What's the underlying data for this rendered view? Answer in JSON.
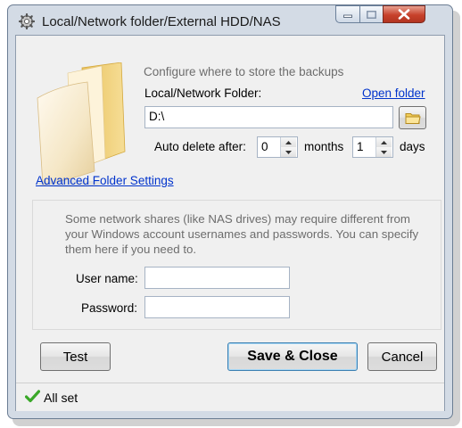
{
  "window": {
    "title": "Local/Network folder/External HDD/NAS",
    "icons": {
      "title": "gear-icon",
      "minimize": "minimize-icon",
      "maximize": "maximize-icon",
      "close": "close-icon"
    }
  },
  "main": {
    "description": "Configure where to store the backups",
    "folder_label": "Local/Network Folder:",
    "open_folder_link": "Open folder",
    "folder_value": "D:\\",
    "browse_icon": "folder-icon",
    "auto_delete_label": "Auto delete after:",
    "months_value": "0",
    "months_label": "months",
    "days_value": "1",
    "days_label": "days",
    "advanced_link": "Advanced Folder Settings"
  },
  "credentials": {
    "info": "Some network shares (like NAS drives) may require different from your Windows account usernames and passwords. You can specify them here if you need to.",
    "username_label": "User name:",
    "username_value": "",
    "password_label": "Password:",
    "password_value": ""
  },
  "buttons": {
    "test": "Test",
    "save_close": "Save & Close",
    "cancel": "Cancel"
  },
  "status": {
    "icon": "checkmark-icon",
    "text": "All set"
  },
  "colors": {
    "link": "#0033cc",
    "close_button": "#c7412b",
    "check": "#3aa829"
  }
}
